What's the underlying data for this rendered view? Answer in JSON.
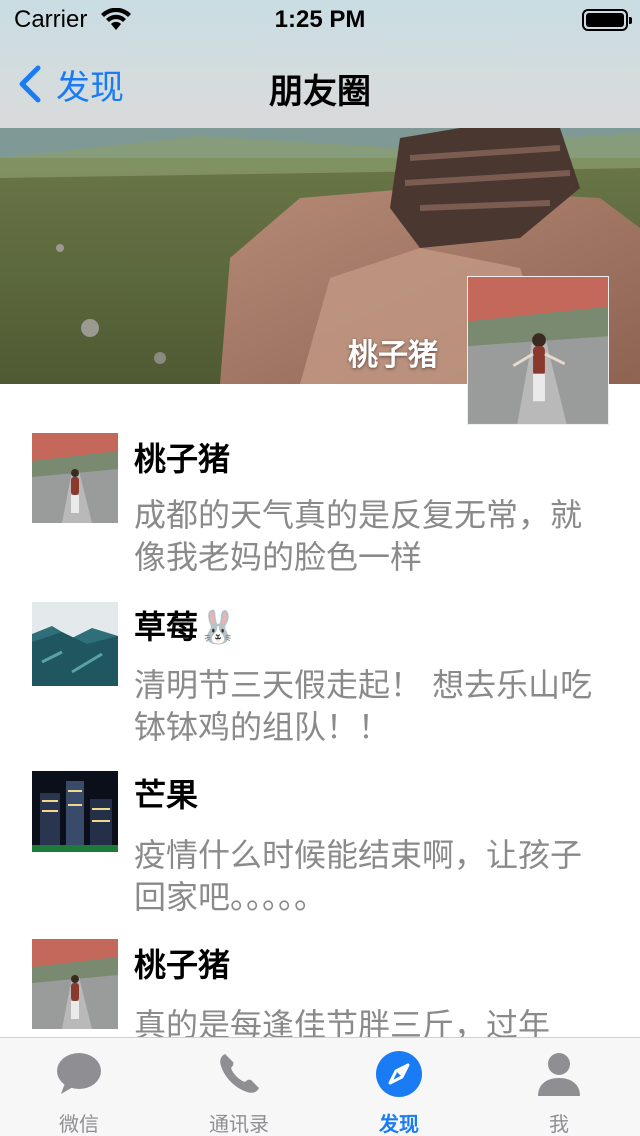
{
  "status_bar": {
    "carrier": "Carrier",
    "time": "1:25 PM"
  },
  "nav": {
    "back_label": "发现",
    "title": "朋友圈"
  },
  "cover": {
    "username": "桃子猪"
  },
  "posts": [
    {
      "name": "桃子猪",
      "text": "成都的天气真的是反复无常，就像我老妈的脸色一样"
    },
    {
      "name": "草莓🐰",
      "text": "清明节三天假走起！ 想去乐山吃钵钵鸡的组队！！"
    },
    {
      "name": "芒果",
      "text": "疫情什么时候能结束啊，让孩子回家吧。。。。。"
    },
    {
      "name": "桃子猪",
      "text": "真的是每逢佳节胖三斤，过年"
    }
  ],
  "tabs": [
    {
      "label": "微信",
      "icon": "chat-bubble-icon"
    },
    {
      "label": "通讯录",
      "icon": "phone-icon"
    },
    {
      "label": "发现",
      "icon": "compass-icon"
    },
    {
      "label": "我",
      "icon": "person-icon"
    }
  ],
  "colors": {
    "accent": "#1a7cf5",
    "tab_inactive": "#8e8e93",
    "post_text": "#8a8a8a"
  }
}
